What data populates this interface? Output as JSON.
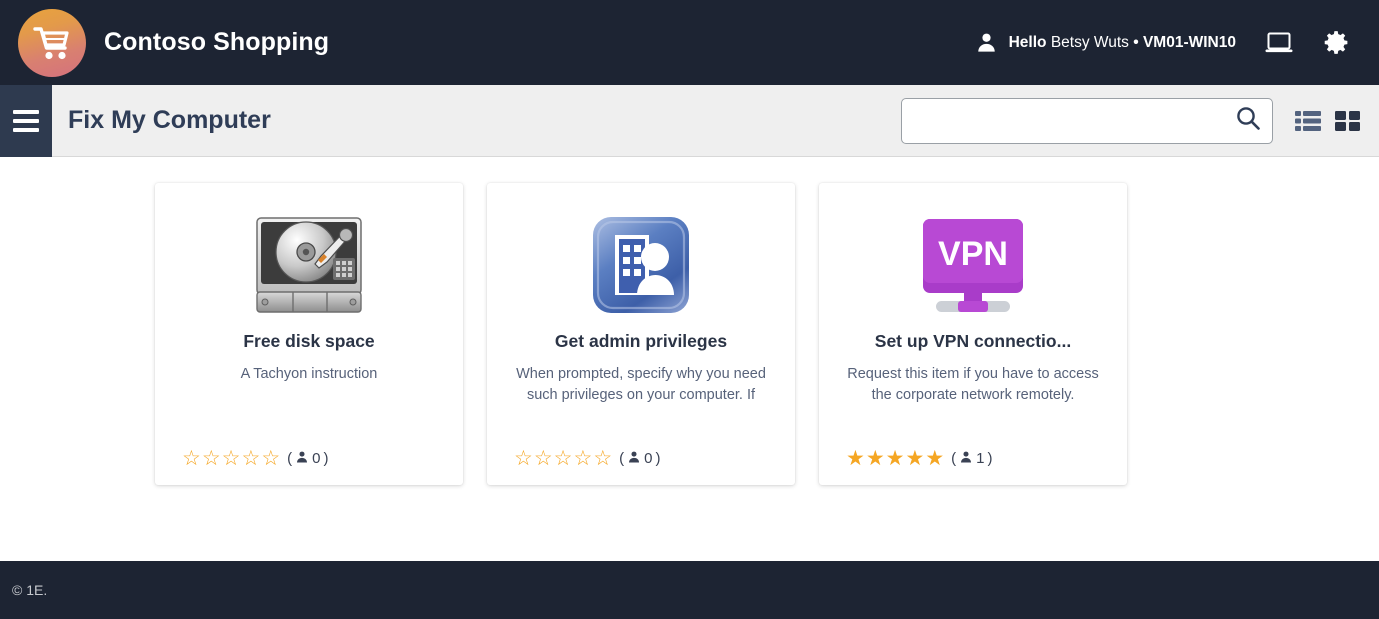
{
  "header": {
    "brand_title": "Contoso Shopping",
    "logo_icon": "shopping-cart-icon",
    "user_greeting": "Hello",
    "user_name": "Betsy Wuts",
    "device_separator": "• VM01-WIN10",
    "user_icon": "person-icon",
    "device_icon": "laptop-icon",
    "settings_icon": "gear-icon",
    "background_color": "#1d2433"
  },
  "subheader": {
    "menu_icon": "hamburger-menu-icon",
    "page_title": "Fix My Computer",
    "search": {
      "value": "",
      "placeholder": "",
      "icon": "search-icon"
    },
    "view_list_icon": "list-view-icon",
    "view_grid_icon": "grid-view-icon",
    "background_color": "#efefef"
  },
  "catalog": {
    "items": [
      {
        "icon": "hard-disk-drive-icon",
        "title": "Free disk space",
        "description": "A Tachyon instruction",
        "rating": 0,
        "rating_max": 5,
        "rating_count": "0",
        "count_icon": "person-icon"
      },
      {
        "icon": "admin-privileges-icon",
        "title": "Get admin privileges",
        "description": "When prompted, specify why you need such privileges on your computer. If",
        "rating": 0,
        "rating_max": 5,
        "rating_count": "0",
        "count_icon": "person-icon"
      },
      {
        "icon": "vpn-monitor-icon",
        "title": "Set up VPN connectio...",
        "description": "Request this item if you have to access the corporate network remotely.",
        "rating": 5,
        "rating_max": 5,
        "rating_count": "1",
        "count_icon": "person-icon"
      }
    ],
    "star_color": "#f5a623"
  },
  "footer": {
    "copyright": "© 1E.",
    "background_color": "#1d2433"
  }
}
